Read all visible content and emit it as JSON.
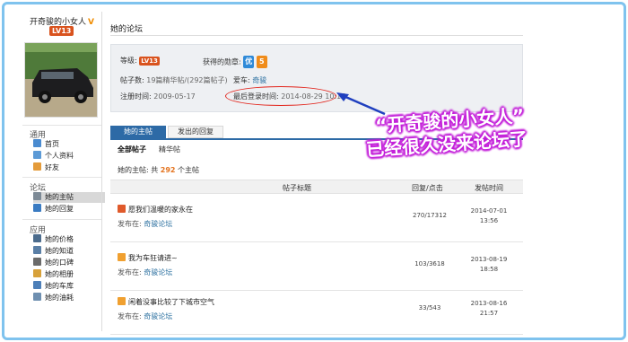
{
  "user": {
    "name": "开奇骏的小女人",
    "vip_badge": "V",
    "level": "LV13"
  },
  "sidebar": {
    "section_general": "通用",
    "general_items": [
      {
        "label": "首页",
        "icon": "home-icon"
      },
      {
        "label": "个人资料",
        "icon": "profile-icon"
      },
      {
        "label": "好友",
        "icon": "friends-icon"
      }
    ],
    "section_forum": "论坛",
    "forum_items": [
      {
        "label": "她的主帖",
        "icon": "posts-icon"
      },
      {
        "label": "她的回复",
        "icon": "replies-icon"
      }
    ],
    "section_apps": "应用",
    "app_items": [
      {
        "label": "她的价格",
        "icon": "price-icon"
      },
      {
        "label": "她的知道",
        "icon": "knowledge-icon"
      },
      {
        "label": "她的口碑",
        "icon": "reputation-icon"
      },
      {
        "label": "她的相册",
        "icon": "album-icon"
      },
      {
        "label": "她的车库",
        "icon": "garage-icon"
      },
      {
        "label": "她的油耗",
        "icon": "fuel-icon"
      }
    ]
  },
  "main": {
    "title": "她的论坛",
    "info": {
      "level_label": "等级:",
      "level_value": "LV13",
      "medals_label": "获得的勋章:",
      "medals": [
        "优",
        "5"
      ],
      "posts_label": "帖子数:",
      "posts_value": "19篇精华帖/",
      "posts_total": "(292篇帖子)",
      "car_label": "爱车:",
      "car_value": "奇骏",
      "reg_label": "注册时间:",
      "reg_value": "2009-05-17",
      "last_login_label": "最后登录时间:",
      "last_login_value": "2014-08-29 10:14"
    },
    "tabs": [
      "她的主帖",
      "发出的回复"
    ],
    "subtabs": [
      "全部帖子",
      "精华帖"
    ],
    "count": {
      "prefix": "她的主帖: 共",
      "number": "292",
      "suffix": "个主帖"
    },
    "columns": [
      "帖子标题",
      "回复/点击",
      "发帖时间"
    ],
    "posts": [
      {
        "title": "愿我们温暖的家永在",
        "posted_in_label": "发布在:",
        "forum": "奇骏论坛",
        "stats": "270/17312",
        "date": "2014-07-01",
        "time": "13:56",
        "icon_color": "#e05a2b"
      },
      {
        "title": "我为车狂请进~",
        "posted_in_label": "发布在:",
        "forum": "奇骏论坛",
        "stats": "103/3618",
        "date": "2013-08-19",
        "time": "18:58",
        "icon_color": "#f0a030"
      },
      {
        "title": "闲着没事比较了下城市空气",
        "posted_in_label": "发布在:",
        "forum": "奇骏论坛",
        "stats": "33/543",
        "date": "2013-08-16",
        "time": "21:57",
        "icon_color": "#f0a030"
      }
    ]
  },
  "annotation": {
    "line1": "“开奇骏的小女人”",
    "line2": "已经很久没来论坛了"
  }
}
